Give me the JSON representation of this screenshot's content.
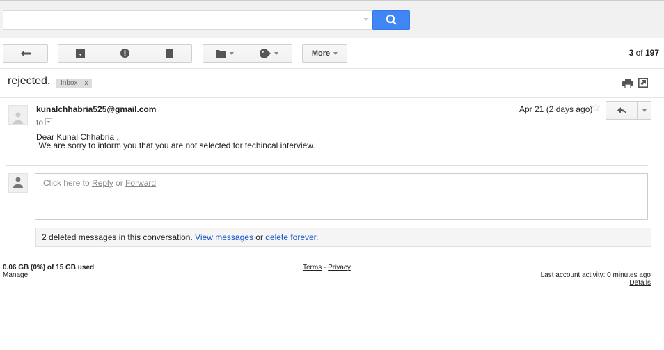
{
  "search": {
    "placeholder": "",
    "value": ""
  },
  "toolbar": {
    "more_label": "More",
    "page_count": {
      "current_range": "3",
      "of_label": "of",
      "total": "197"
    }
  },
  "thread": {
    "subject": "rejected.",
    "labels": [
      {
        "name": "Inbox",
        "remove": "x"
      }
    ]
  },
  "message": {
    "sender": "kunalchhabria525@gmail.com",
    "to_label": "to",
    "date": "Apr 21 (2 days ago)",
    "body_lines": [
      "Dear Kunal Chhabria ,",
      " We are sorry to inform you that you are not selected for techincal interview."
    ]
  },
  "reply_box": {
    "prefix": "Click here to ",
    "reply_link": "Reply",
    "or": " or ",
    "forward_link": "Forward"
  },
  "deleted_notice": {
    "text": "2 deleted messages in this conversation. ",
    "view_link": "View messages",
    "or": " or ",
    "delete_link": "delete forever",
    "end": "."
  },
  "footer": {
    "storage": "0.06 GB (0%) of 15 GB used",
    "manage": "Manage",
    "terms": "Terms",
    "separator": " - ",
    "privacy": "Privacy",
    "last_activity": "Last account activity: 0 minutes ago",
    "details": "Details"
  },
  "colors": {
    "accent": "#4285f4",
    "link": "#1155cc"
  }
}
